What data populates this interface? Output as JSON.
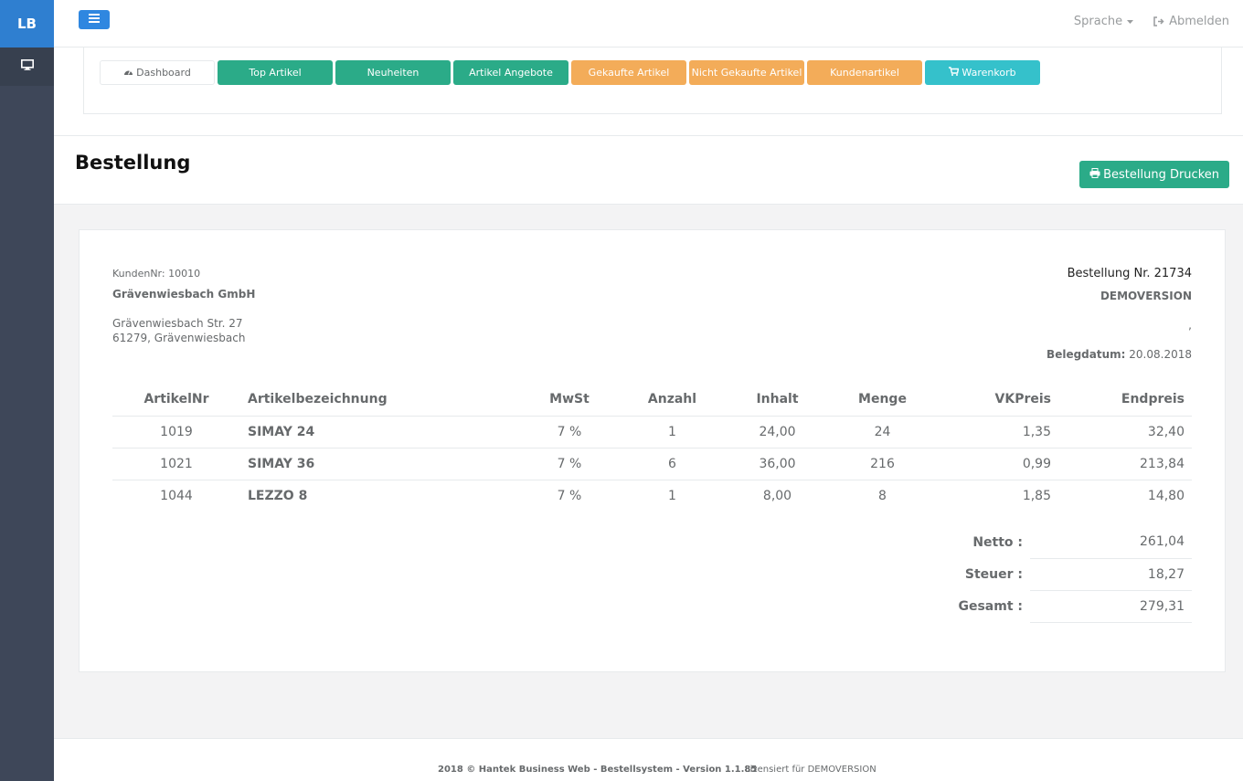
{
  "sidebar": {
    "logo": "LB",
    "items": [
      {
        "icon": "monitor-icon"
      }
    ]
  },
  "topbar": {
    "language": "Sprache",
    "logout": "Abmelden"
  },
  "nav": {
    "buttons": [
      {
        "label": "Dashboard",
        "icon": "dashboard-icon",
        "color": "#ffffff"
      },
      {
        "label": "Top Artikel",
        "color": "#2bab88"
      },
      {
        "label": "Neuheiten",
        "color": "#2bab88"
      },
      {
        "label": "Artikel Angebote",
        "color": "#2bab88"
      },
      {
        "label": "Gekaufte Artikel",
        "color": "#f3ac59"
      },
      {
        "label": "Nicht Gekaufte Artikel",
        "color": "#f3ac59"
      },
      {
        "label": "Kundenartikel",
        "color": "#f3ac59"
      },
      {
        "label": "Warenkorb",
        "icon": "cart-icon",
        "color": "#35c1cb"
      }
    ]
  },
  "page": {
    "title": "Bestellung",
    "print_label": "Bestellung Drucken"
  },
  "customer": {
    "nr_label": "KundenNr:",
    "nr": "10010",
    "name": "Grävenwiesbach GmbH",
    "street": "Grävenwiesbach Str. 27",
    "city": "61279, Grävenwiesbach"
  },
  "order": {
    "number_label": "Bestellung Nr.",
    "number": "21734",
    "company": "DEMOVERSION",
    "comma": ",",
    "date_label": "Belegdatum:",
    "date": "20.08.2018"
  },
  "table": {
    "headers": [
      "ArtikelNr",
      "Artikelbezeichnung",
      "MwSt",
      "Anzahl",
      "Inhalt",
      "Menge",
      "VKPreis",
      "Endpreis"
    ],
    "rows": [
      [
        "1019",
        "SIMAY 24",
        "7 %",
        "1",
        "24,00",
        "24",
        "1,35",
        "32,40"
      ],
      [
        "1021",
        "SIMAY 36",
        "7 %",
        "6",
        "36,00",
        "216",
        "0,99",
        "213,84"
      ],
      [
        "1044",
        "LEZZO 8",
        "7 %",
        "1",
        "8,00",
        "8",
        "1,85",
        "14,80"
      ]
    ]
  },
  "totals": [
    {
      "label": "Netto :",
      "value": "261,04"
    },
    {
      "label": "Steuer :",
      "value": "18,27"
    },
    {
      "label": "Gesamt :",
      "value": "279,31"
    }
  ],
  "footer": {
    "copyright": "2018 © Hantek Business Web - Bestellsystem - Version 1.1.85",
    "license": "Lizensiert für DEMOVERSION"
  }
}
